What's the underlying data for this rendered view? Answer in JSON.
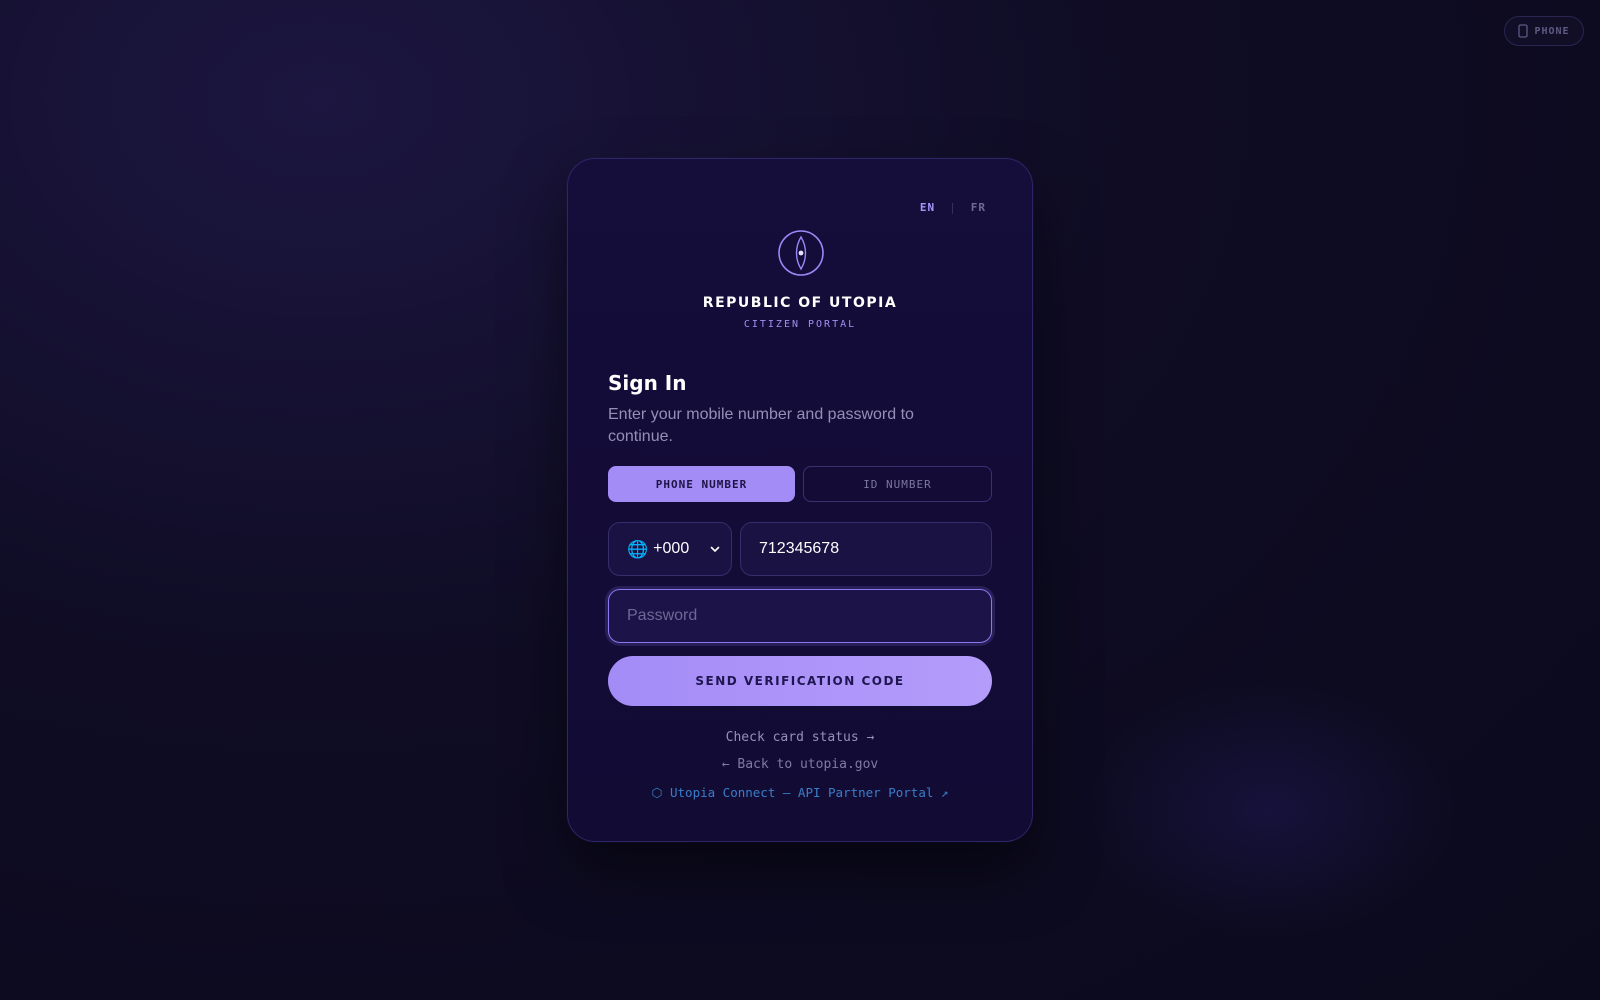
{
  "view_toggle": {
    "label": "PHONE",
    "icon": "phone-icon"
  },
  "language": {
    "options": [
      "EN",
      "FR"
    ],
    "separator": "|",
    "active": "EN"
  },
  "brand": {
    "emblem_icon": "compass-emblem-icon",
    "name": "REPUBLIC OF UTOPIA",
    "subtitle": "CITIZEN PORTAL"
  },
  "form": {
    "title": "Sign In",
    "subtitle": "Enter your mobile number and password to continue.",
    "tabs": [
      {
        "label": "PHONE NUMBER",
        "active": true
      },
      {
        "label": "ID NUMBER",
        "active": false
      }
    ],
    "country_select": {
      "flag": "🌐",
      "code": "+000"
    },
    "phone_value": "712345678",
    "password_placeholder": "Password",
    "submit_label": "SEND VERIFICATION CODE"
  },
  "links": {
    "card_status": "Check card status →",
    "back": "← Back to utopia.gov",
    "api_portal": "⬡ Utopia Connect — API Partner Portal ↗"
  },
  "colors": {
    "accent": "#a48cf7",
    "background": "#0f0c24",
    "card": "#150d3a",
    "link_blue": "#3a7ec9"
  }
}
